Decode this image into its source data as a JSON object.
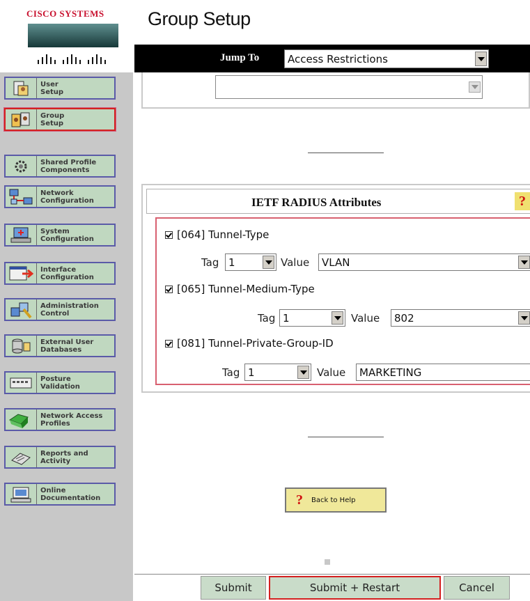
{
  "brand": {
    "logo_text": "Cisco Systems"
  },
  "page": {
    "title": "Group Setup"
  },
  "jump": {
    "label": "Jump To",
    "selected": "Access Restrictions"
  },
  "nav": {
    "items": [
      {
        "label": "User\nSetup",
        "icon": "user-setup-icon"
      },
      {
        "label": "Group\nSetup",
        "icon": "group-setup-icon"
      },
      {
        "label": "Shared Profile\nComponents",
        "icon": "shared-profile-icon"
      },
      {
        "label": "Network\nConfiguration",
        "icon": "network-config-icon"
      },
      {
        "label": "System\nConfiguration",
        "icon": "system-config-icon"
      },
      {
        "label": "Interface\nConfiguration",
        "icon": "interface-config-icon"
      },
      {
        "label": "Administration\nControl",
        "icon": "admin-control-icon"
      },
      {
        "label": "External User\nDatabases",
        "icon": "external-db-icon"
      },
      {
        "label": "Posture\nValidation",
        "icon": "posture-icon"
      },
      {
        "label": "Network Access\nProfiles",
        "icon": "network-access-icon"
      },
      {
        "label": "Reports and\nActivity",
        "icon": "reports-icon"
      },
      {
        "label": "Online\nDocumentation",
        "icon": "online-doc-icon"
      }
    ],
    "active_index": 1
  },
  "upper": {
    "select_value": ""
  },
  "ietf": {
    "title": "IETF RADIUS Attributes",
    "help_glyph": "?",
    "attributes": [
      {
        "checked": true,
        "name": "[064] Tunnel-Type",
        "tag_label": "Tag",
        "tag": "1",
        "value_label": "Value",
        "value": "VLAN"
      },
      {
        "checked": true,
        "name": "[065] Tunnel-Medium-Type",
        "tag_label": "Tag",
        "tag": "1",
        "value_label": "Value",
        "value": "802"
      },
      {
        "checked": true,
        "name": "[081] Tunnel-Private-Group-ID",
        "tag_label": "Tag",
        "tag": "1",
        "value_label": "Value",
        "value": "MARKETING"
      }
    ]
  },
  "help_button": {
    "glyph": "?",
    "label": "Back to Help"
  },
  "buttons": {
    "submit": "Submit",
    "submit_restart": "Submit + Restart",
    "cancel": "Cancel"
  },
  "colors": {
    "nav_bg": "#c0d8c0",
    "active_border": "#d42020",
    "jumpbar": "#000000",
    "attr_box_border": "#d86070"
  }
}
